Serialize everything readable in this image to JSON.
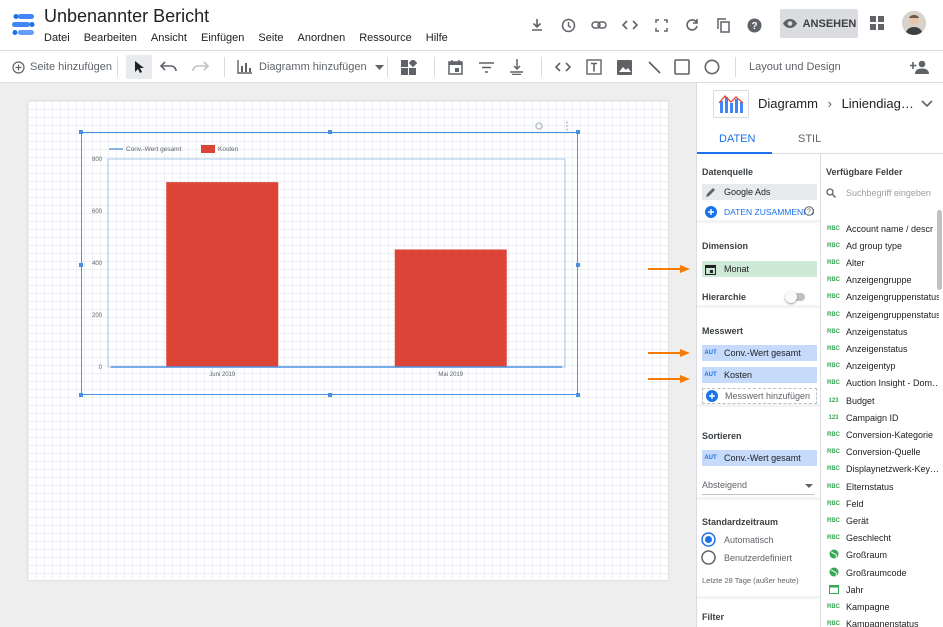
{
  "header": {
    "title": "Unbenannter Bericht",
    "menu": [
      "Datei",
      "Bearbeiten",
      "Ansicht",
      "Einfügen",
      "Seite",
      "Anordnen",
      "Ressource",
      "Hilfe"
    ],
    "view_button": "ANSEHEN"
  },
  "toolbar": {
    "add_page": "Seite hinzufügen",
    "add_chart": "Diagramm hinzufügen",
    "layout_theme": "Layout und Design"
  },
  "chart_data": {
    "type": "bar",
    "categories": [
      "Juni 2019",
      "Mai 2019"
    ],
    "series": [
      {
        "name": "Conv.-Wert gesamt",
        "values": [
          0,
          0
        ],
        "color": "#4a90e2"
      },
      {
        "name": "Kosten",
        "values": [
          711,
          452
        ],
        "color": "#db4437"
      }
    ],
    "yticks": [
      "800",
      "600",
      "400",
      "200",
      "0"
    ],
    "ylim": [
      0,
      800
    ]
  },
  "panel": {
    "breadcrumb": "Diagramm",
    "chart_type": "Liniendiag…",
    "tabs": [
      "DATEN",
      "STIL"
    ],
    "datasource": {
      "title": "Datenquelle",
      "name": "Google Ads",
      "blend": "DATEN ZUSAMMENFÜ"
    },
    "dimension": {
      "title": "Dimension",
      "value": "Monat"
    },
    "hierarchy": {
      "title": "Hierarchie"
    },
    "metric": {
      "title": "Messwert",
      "items": [
        "Conv.-Wert gesamt",
        "Kosten"
      ],
      "add": "Messwert hinzufügen",
      "badge": "AUT"
    },
    "sort": {
      "title": "Sortieren",
      "value": "Conv.-Wert gesamt",
      "order": "Absteigend"
    },
    "date_range": {
      "title": "Standardzeitraum",
      "auto": "Automatisch",
      "custom": "Benutzerdefiniert",
      "note": "Letzte 28 Tage (außer heute)"
    },
    "filter": {
      "title": "Filter"
    },
    "available": {
      "title": "Verfügbare Felder",
      "search_placeholder": "Suchbegriff eingeben",
      "fields": [
        {
          "type": "RBC",
          "name": "Account name / descr"
        },
        {
          "type": "RBC",
          "name": "Ad group type"
        },
        {
          "type": "RBC",
          "name": "Alter"
        },
        {
          "type": "RBC",
          "name": "Anzeigengruppe"
        },
        {
          "type": "RBC",
          "name": "Anzeigengruppenstatus"
        },
        {
          "type": "RBC",
          "name": "Anzeigengruppenstatus"
        },
        {
          "type": "RBC",
          "name": "Anzeigenstatus"
        },
        {
          "type": "RBC",
          "name": "Anzeigenstatus"
        },
        {
          "type": "RBC",
          "name": "Anzeigentyp"
        },
        {
          "type": "RBC",
          "name": "Auction Insight - Dom…"
        },
        {
          "type": "123",
          "name": "Budget"
        },
        {
          "type": "123",
          "name": "Campaign ID"
        },
        {
          "type": "RBC",
          "name": "Conversion-Kategorie"
        },
        {
          "type": "RBC",
          "name": "Conversion-Quelle"
        },
        {
          "type": "RBC",
          "name": "Displaynetzwerk-Key…"
        },
        {
          "type": "RBC",
          "name": "Elternstatus"
        },
        {
          "type": "RBC",
          "name": "Feld"
        },
        {
          "type": "RBC",
          "name": "Gerät"
        },
        {
          "type": "RBC",
          "name": "Geschlecht"
        },
        {
          "type": "geo",
          "name": "Großraum"
        },
        {
          "type": "geo",
          "name": "Großraumcode"
        },
        {
          "type": "cal",
          "name": "Jahr"
        },
        {
          "type": "RBC",
          "name": "Kampagne"
        },
        {
          "type": "RBC",
          "name": "Kampagnenstatus"
        },
        {
          "type": "RBC",
          "name": "Kampagnenstatus"
        }
      ]
    }
  }
}
